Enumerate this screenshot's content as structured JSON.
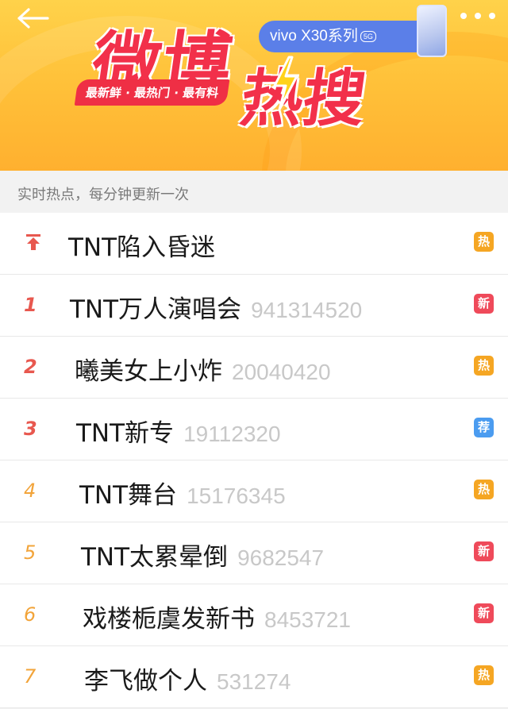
{
  "header": {
    "title_weibo": "微博",
    "title_resou": "热搜",
    "tagline": "最新鲜 · 最热门 · 最有料",
    "promo_text": "vivo X30系列",
    "promo_5g": "5G",
    "colors": {
      "banner": "#ffc23a",
      "title": "#f2304a",
      "promo": "#5b7fe8"
    }
  },
  "subheader": {
    "text": "实时热点，每分钟更新一次"
  },
  "list": {
    "items": [
      {
        "rank": "",
        "title": "TNT陷入昏迷",
        "count": "",
        "badge": "热",
        "badge_color": "#f5a623",
        "pinned": true
      },
      {
        "rank": "1",
        "title": "TNT万人演唱会",
        "count": "941314520",
        "badge": "新",
        "badge_color": "#ef4a5a"
      },
      {
        "rank": "2",
        "title": "曦美女上小炸",
        "count": "20040420",
        "badge": "热",
        "badge_color": "#f5a623"
      },
      {
        "rank": "3",
        "title": "TNT新专",
        "count": "19112320",
        "badge": "荐",
        "badge_color": "#4b9cf0"
      },
      {
        "rank": "4",
        "title": "TNT舞台",
        "count": "15176345",
        "badge": "热",
        "badge_color": "#f5a623"
      },
      {
        "rank": "5",
        "title": "TNT太累晕倒",
        "count": "9682547",
        "badge": "新",
        "badge_color": "#ef4a5a"
      },
      {
        "rank": "6",
        "title": "戏楼栀虞发新书",
        "count": "8453721",
        "badge": "新",
        "badge_color": "#ef4a5a"
      },
      {
        "rank": "7",
        "title": "李飞做个人",
        "count": "531274",
        "badge": "热",
        "badge_color": "#f5a623"
      }
    ]
  }
}
